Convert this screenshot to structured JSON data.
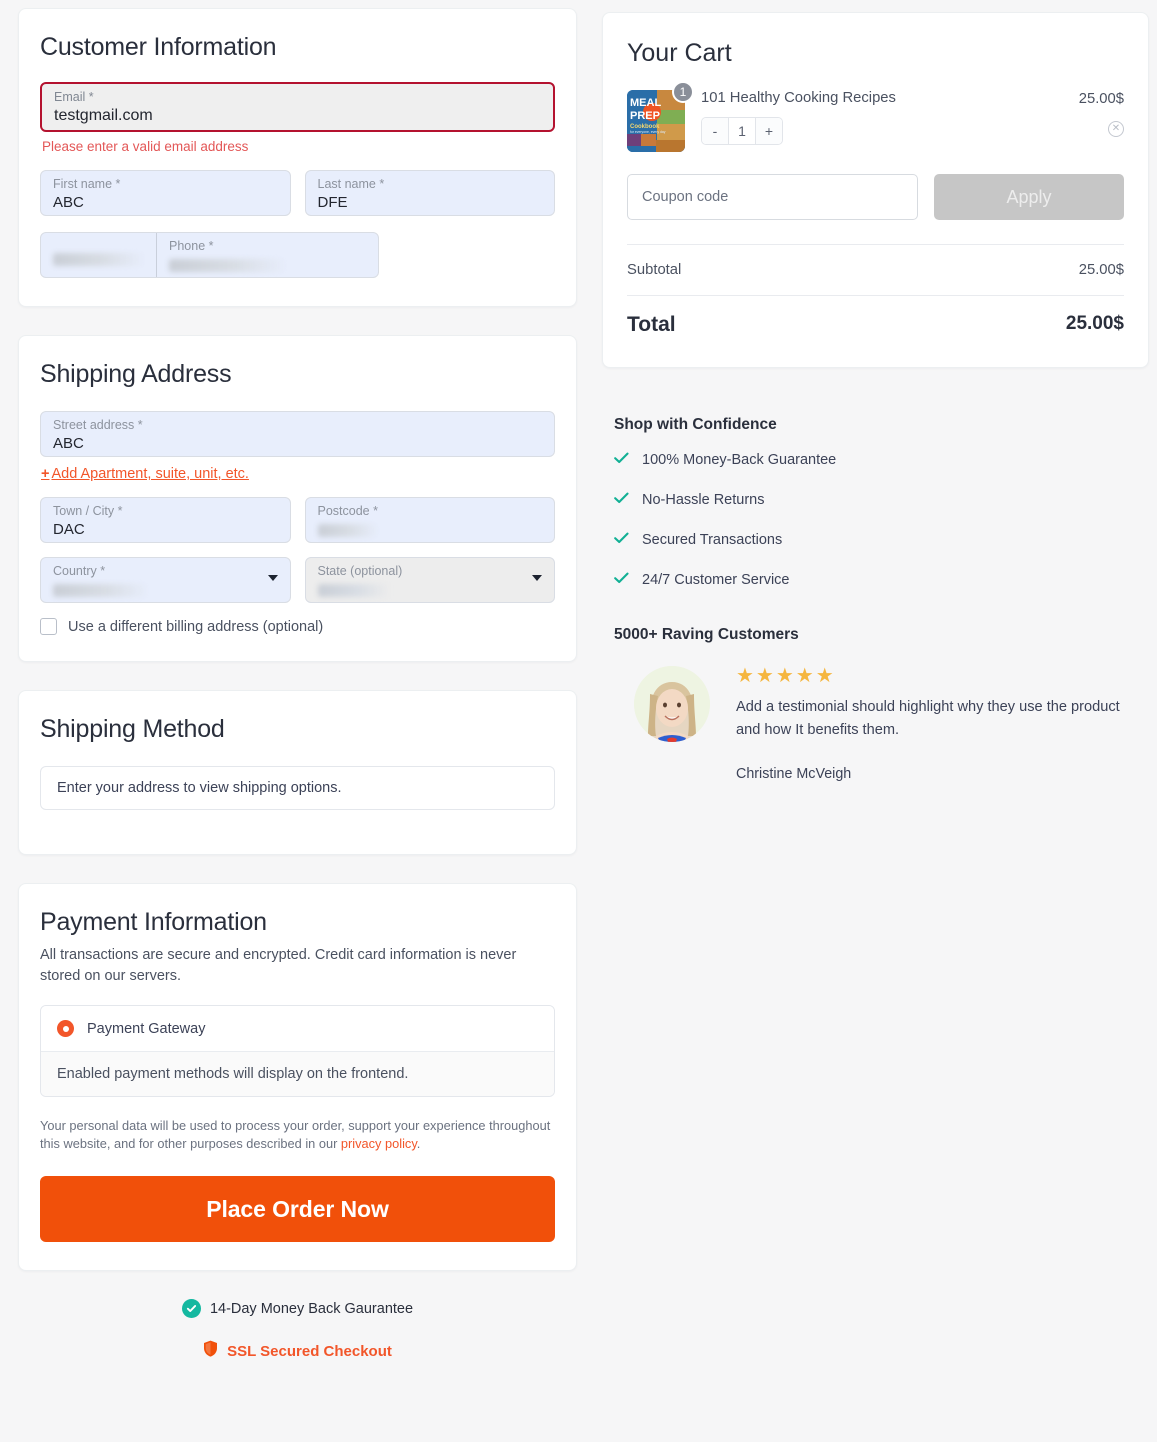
{
  "customer": {
    "title": "Customer Information",
    "email": {
      "label": "Email *",
      "value": "testgmail.com",
      "error": "Please enter a valid email address"
    },
    "first_name": {
      "label": "First name *",
      "value": "ABC"
    },
    "last_name": {
      "label": "Last name *",
      "value": "DFE"
    },
    "phone": {
      "label": "Phone *",
      "value": "",
      "country_code": ""
    }
  },
  "shipping": {
    "title": "Shipping Address",
    "street": {
      "label": "Street address *",
      "value": "ABC"
    },
    "add_apartment": "Add Apartment, suite, unit, etc.",
    "add_apartment_plus": "+",
    "city": {
      "label": "Town / City *",
      "value": "DAC"
    },
    "postcode": {
      "label": "Postcode *",
      "value": ""
    },
    "country": {
      "label": "Country *",
      "value": ""
    },
    "state": {
      "label": "State (optional)",
      "value": ""
    },
    "billing_checkbox": "Use a different billing address (optional)"
  },
  "shipping_method": {
    "title": "Shipping Method",
    "empty_message": "Enter your address to view shipping options."
  },
  "payment": {
    "title": "Payment Information",
    "note": "All transactions are secure and encrypted. Credit card information is never stored on our servers.",
    "gateway_label": "Payment Gateway",
    "gateway_body": "Enabled payment methods will display on the frontend.",
    "privacy_pre": "Your personal data will be used to process your order, support your experience throughout this website, and for other purposes described in our ",
    "privacy_link": "privacy policy",
    "privacy_post": ".",
    "place_order": "Place Order Now"
  },
  "trust": {
    "money_back": "14-Day Money Back Gaurantee",
    "ssl": "SSL Secured Checkout"
  },
  "cart": {
    "title": "Your Cart",
    "item": {
      "name": "101 Healthy Cooking Recipes",
      "price": "25.00$",
      "quantity": "1",
      "badge": "1",
      "minus": "-",
      "plus": "+",
      "remove": "✕",
      "image_alt": "meal-prep-cookbook-cover",
      "image_line1": "MEAL",
      "image_line2": "PREP",
      "image_line3": "Cookbook"
    },
    "coupon_placeholder": "Coupon code",
    "coupon_value": "",
    "apply_label": "Apply",
    "subtotal_label": "Subtotal",
    "subtotal_value": "25.00$",
    "total_label": "Total",
    "total_value": "25.00$"
  },
  "confidence": {
    "heading": "Shop with Confidence",
    "items": [
      "100% Money-Back Guarantee",
      "No-Hassle Returns",
      "Secured Transactions",
      "24/7 Customer Service"
    ]
  },
  "testimonial": {
    "heading": "5000+ Raving Customers",
    "stars": "★★★★★",
    "rating": 5,
    "text": "Add a testimonial should highlight why they use the product and how It benefits them.",
    "name": "Christine McVeigh"
  },
  "colors": {
    "accent_orange": "#f1500a",
    "link_orange": "#f2562a",
    "error_red": "#b4122f",
    "error_text": "#e35757",
    "teal": "#14b8a0",
    "star_gold": "#f5b63f",
    "field_blue": "#e8eefc"
  }
}
